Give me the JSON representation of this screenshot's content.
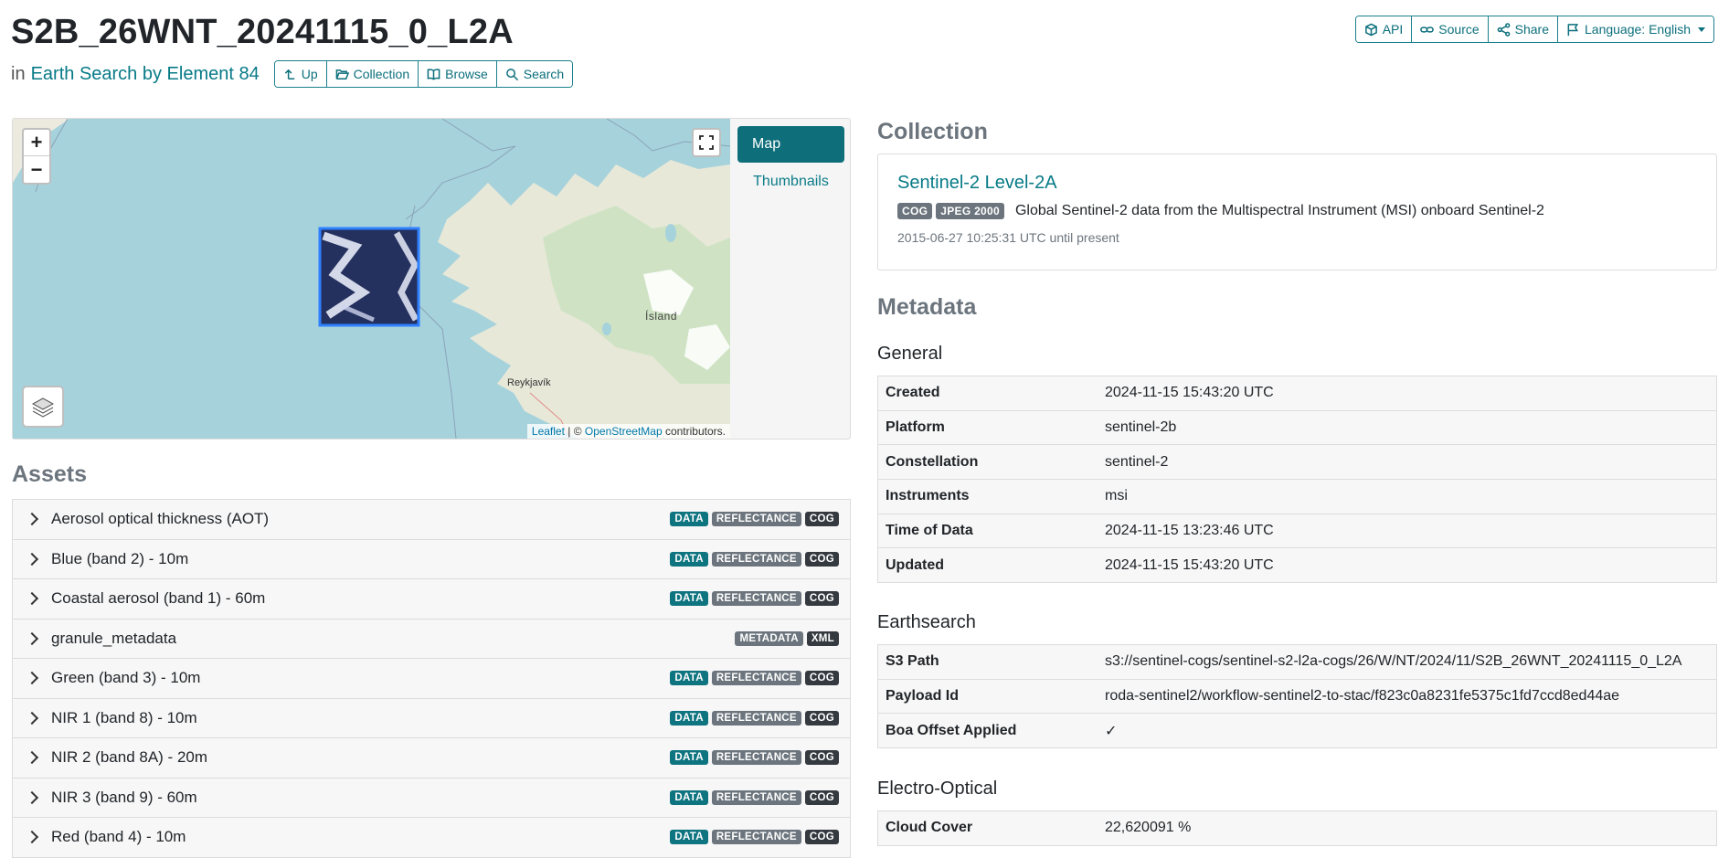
{
  "header": {
    "title": "S2B_26WNT_20241115_0_L2A",
    "in_label": "in",
    "catalog_link": "Earth Search by Element 84",
    "nav_buttons": [
      {
        "label": "Up",
        "icon": "arrow-up-icon"
      },
      {
        "label": "Collection",
        "icon": "folder-open-icon"
      },
      {
        "label": "Browse",
        "icon": "book-icon"
      },
      {
        "label": "Search",
        "icon": "search-icon"
      }
    ],
    "top_buttons": [
      {
        "label": "API",
        "icon": "box-icon"
      },
      {
        "label": "Source",
        "icon": "link-icon"
      },
      {
        "label": "Share",
        "icon": "share-icon"
      },
      {
        "label": "Language: English",
        "icon": "flag-icon"
      }
    ]
  },
  "map": {
    "zoom_in": "+",
    "zoom_out": "−",
    "place_label_iceland": "Ísland",
    "place_label_reykjavik": "Reykjavík",
    "attribution_leaflet": "Leaflet",
    "attribution_sep": " | © ",
    "attribution_osm": "OpenStreetMap",
    "attribution_suffix": " contributors.",
    "tabs": {
      "map": "Map",
      "thumbnails": "Thumbnails"
    }
  },
  "assets": {
    "title": "Assets",
    "items": [
      {
        "name": "Aerosol optical thickness (AOT)",
        "badges": [
          "DATA",
          "REFLECTANCE",
          "COG"
        ]
      },
      {
        "name": "Blue (band 2) - 10m",
        "badges": [
          "DATA",
          "REFLECTANCE",
          "COG"
        ]
      },
      {
        "name": "Coastal aerosol (band 1) - 60m",
        "badges": [
          "DATA",
          "REFLECTANCE",
          "COG"
        ]
      },
      {
        "name": "granule_metadata",
        "badges": [
          "METADATA",
          "XML"
        ]
      },
      {
        "name": "Green (band 3) - 10m",
        "badges": [
          "DATA",
          "REFLECTANCE",
          "COG"
        ]
      },
      {
        "name": "NIR 1 (band 8) - 10m",
        "badges": [
          "DATA",
          "REFLECTANCE",
          "COG"
        ]
      },
      {
        "name": "NIR 2 (band 8A) - 20m",
        "badges": [
          "DATA",
          "REFLECTANCE",
          "COG"
        ]
      },
      {
        "name": "NIR 3 (band 9) - 60m",
        "badges": [
          "DATA",
          "REFLECTANCE",
          "COG"
        ]
      },
      {
        "name": "Red (band 4) - 10m",
        "badges": [
          "DATA",
          "REFLECTANCE",
          "COG"
        ]
      }
    ]
  },
  "collection": {
    "title": "Collection",
    "name": "Sentinel-2 Level-2A",
    "badges": [
      "COG",
      "JPEG 2000"
    ],
    "description": "Global Sentinel-2 data from the Multispectral Instrument (MSI) onboard Sentinel-2",
    "date_range": "2015-06-27 10:25:31 UTC until present"
  },
  "metadata": {
    "title": "Metadata",
    "general": {
      "title": "General",
      "rows": [
        {
          "key": "Created",
          "value": "2024-11-15 15:43:20 UTC"
        },
        {
          "key": "Platform",
          "value": "sentinel-2b"
        },
        {
          "key": "Constellation",
          "value": "sentinel-2"
        },
        {
          "key": "Instruments",
          "value": "msi"
        },
        {
          "key": "Time of Data",
          "value": "2024-11-15 13:23:46 UTC"
        },
        {
          "key": "Updated",
          "value": "2024-11-15 15:43:20 UTC"
        }
      ]
    },
    "earthsearch": {
      "title": "Earthsearch",
      "rows": [
        {
          "key": "S3 Path",
          "value": "s3://sentinel-cogs/sentinel-s2-l2a-cogs/26/W/NT/2024/11/S2B_26WNT_20241115_0_L2A"
        },
        {
          "key": "Payload Id",
          "value": "roda-sentinel2/workflow-sentinel2-to-stac/f823c0a8231fe5375c1fd7ccd8ed44ae"
        },
        {
          "key": "Boa Offset Applied",
          "value": "✓"
        }
      ]
    },
    "electro_optical": {
      "title": "Electro-Optical",
      "rows": [
        {
          "key": "Cloud Cover",
          "value": "22,620091 %"
        }
      ]
    }
  },
  "colors": {
    "accent": "#0e6f7b",
    "link": "#077a87",
    "badge_data": "#0e7480",
    "badge_gray": "#6c757d",
    "badge_dark": "#343a40"
  }
}
